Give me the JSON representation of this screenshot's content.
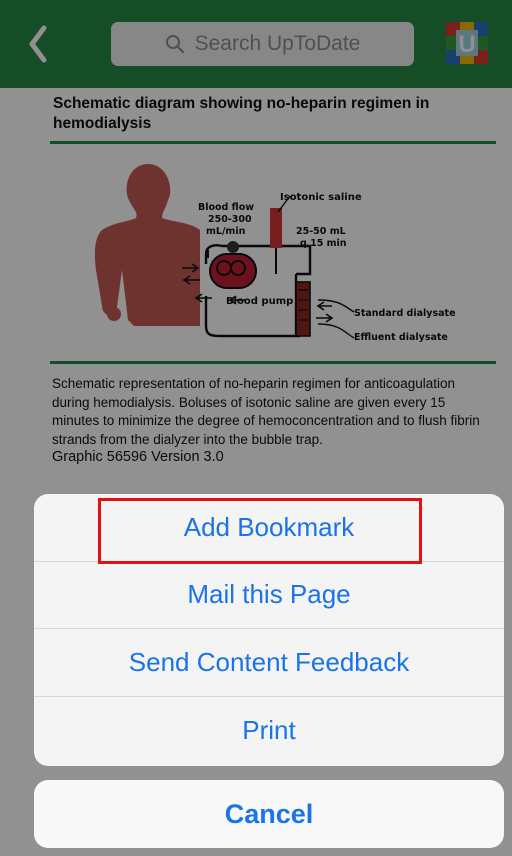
{
  "navbar": {
    "back_icon": "chevron-left-icon",
    "search_placeholder": "Search UpToDate",
    "logo_letter": "U"
  },
  "article": {
    "title": "Schematic diagram showing no-heparin regimen in hemodialysis",
    "caption": "Schematic representation of no-heparin regimen for anticoagulation during hemodialysis. Boluses of isotonic saline are given every 15 minutes to minimize the degree of hemoconcentration and to flush fibrin strands from the dialyzer into the bubble trap.",
    "version": "Graphic 56596 Version 3.0"
  },
  "diagram": {
    "isotonic_saline": "Isotonic saline",
    "blood_flow_1": "Blood flow",
    "blood_flow_2": "250-300",
    "blood_flow_3": "mL/min",
    "dose_1": "25-50 mL",
    "dose_2": "q 15 min",
    "blood_pump": "Blood pump",
    "standard_dialysate": "Standard dialysate",
    "effluent_dialysate": "Effluent dialysate"
  },
  "action_sheet": {
    "options": [
      {
        "label": "Add Bookmark"
      },
      {
        "label": "Mail this Page"
      },
      {
        "label": "Send Content Feedback"
      },
      {
        "label": "Print"
      }
    ],
    "cancel_label": "Cancel"
  },
  "colors": {
    "navbar": "#258a43",
    "action_text": "#1a73e8",
    "highlight": "#e61010"
  }
}
